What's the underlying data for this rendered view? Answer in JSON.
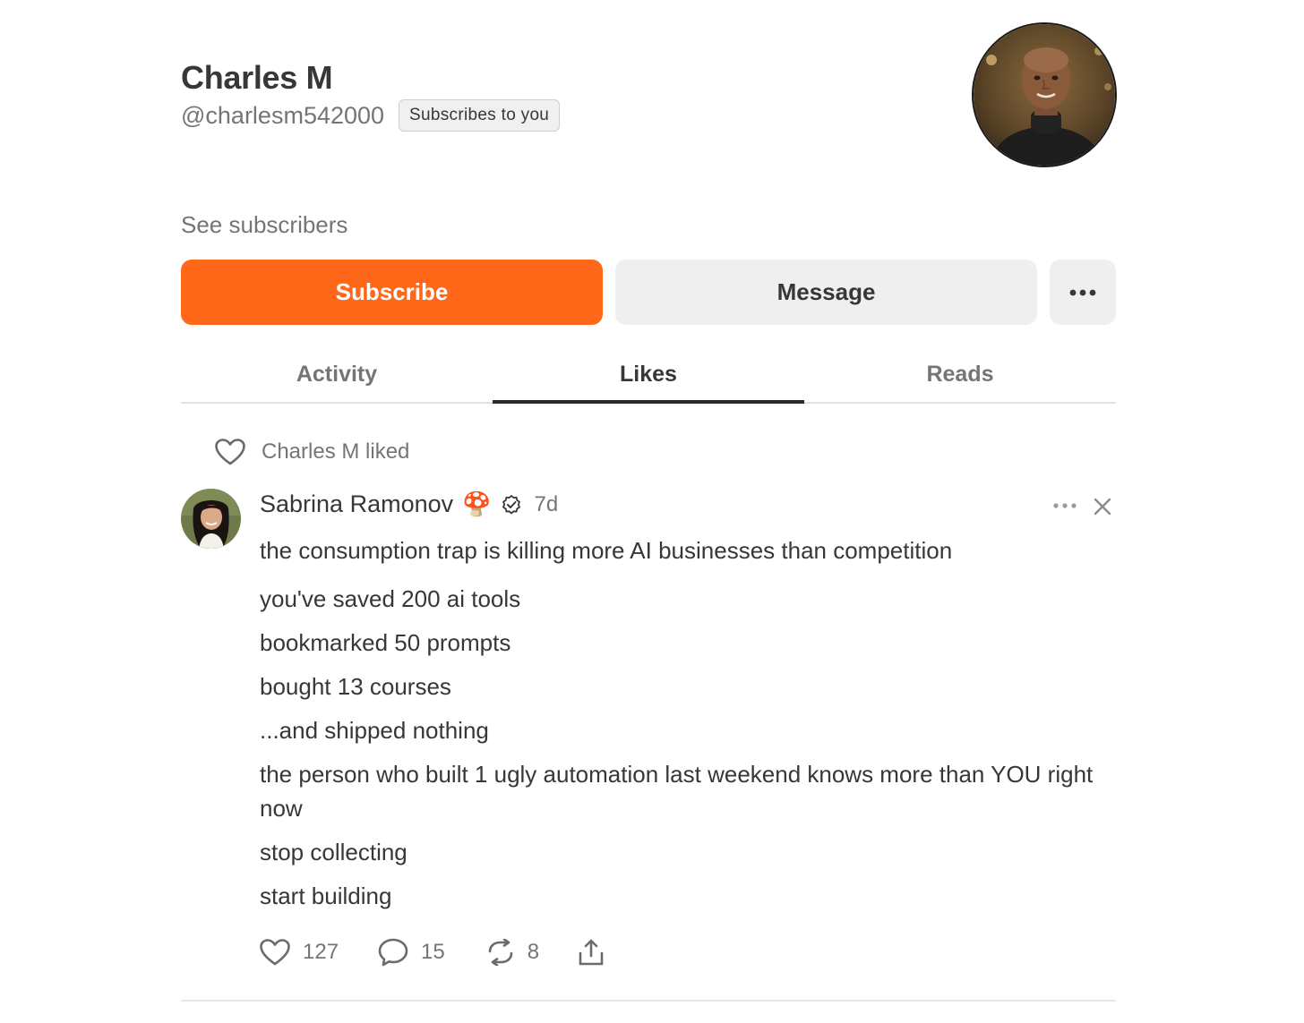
{
  "profile": {
    "name": "Charles M",
    "handle": "@charlesm542000",
    "subscribes_badge": "Subscribes to you",
    "avatar_icon": "profile-photo-man-black-turtleneck"
  },
  "links": {
    "see_subscribers": "See subscribers"
  },
  "buttons": {
    "subscribe": "Subscribe",
    "message": "Message",
    "more": "•••"
  },
  "colors": {
    "accent": "#ff6719",
    "text": "#363737",
    "muted": "#757575"
  },
  "tabs": [
    {
      "label": "Activity",
      "active": false
    },
    {
      "label": "Likes",
      "active": true
    },
    {
      "label": "Reads",
      "active": false
    }
  ],
  "feed": {
    "liked_label": "Charles M liked",
    "post": {
      "author": "Sabrina Ramonov",
      "author_emoji": "🍄",
      "verified_icon": "verified-badge-icon",
      "time": "7d",
      "lines": [
        "the consumption trap is killing more AI businesses than competition",
        "you've saved 200 ai tools",
        "bookmarked 50 prompts",
        "bought 13 courses",
        "...and shipped nothing",
        "the person who built 1 ugly automation last weekend knows more than YOU right now",
        "stop collecting",
        "start building"
      ],
      "likes": "127",
      "comments": "15",
      "restacks": "8"
    }
  }
}
